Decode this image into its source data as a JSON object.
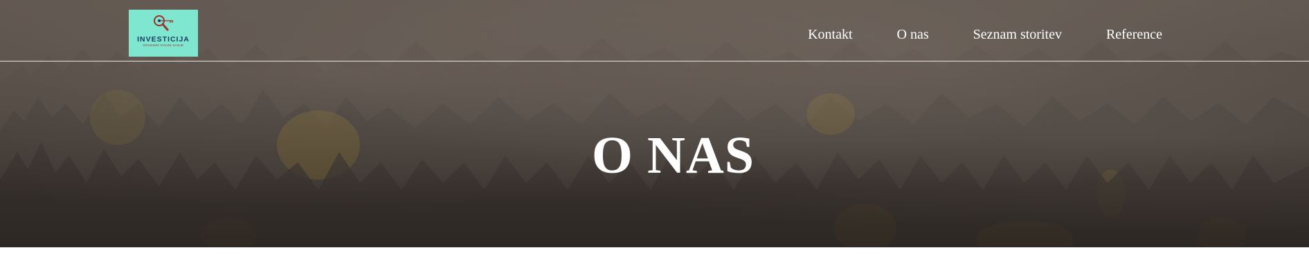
{
  "header": {
    "logo": {
      "brand": "INVESTICIJA",
      "tagline": "GRADIMO SVOJE SANJE",
      "colors": {
        "background": "#7fe6cf",
        "brand": "#1c3b63",
        "icon": "#a0302a"
      }
    },
    "nav": [
      {
        "label": "Kontakt"
      },
      {
        "label": "O nas"
      },
      {
        "label": "Seznam storitev"
      },
      {
        "label": "Reference"
      }
    ]
  },
  "hero": {
    "title": "O NAS",
    "background_image": "misty-forest"
  }
}
